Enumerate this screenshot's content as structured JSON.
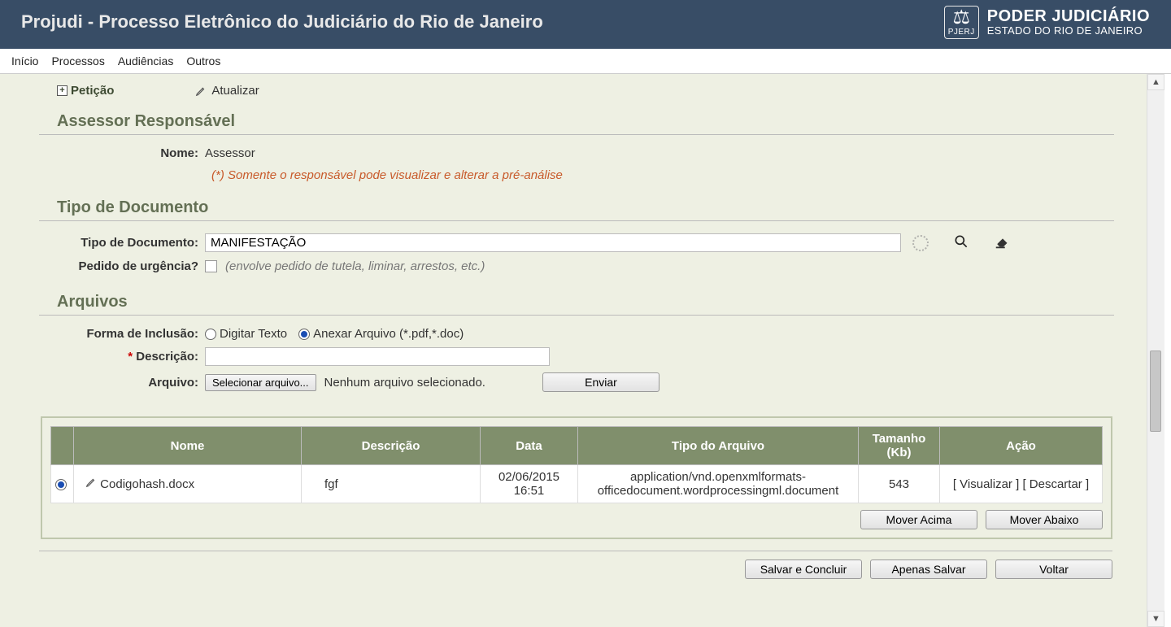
{
  "header": {
    "title": "Projudi - Processo Eletrônico do Judiciário do Rio de Janeiro",
    "logo_small": "PJERJ",
    "right_line1": "PODER JUDICIÁRIO",
    "right_line2": "ESTADO DO RIO DE JANEIRO"
  },
  "menu": {
    "inicio": "Início",
    "processos": "Processos",
    "audiencias": "Audiências",
    "outros": "Outros"
  },
  "top": {
    "peticao": "Petição",
    "atualizar": "Atualizar"
  },
  "assessor": {
    "title": "Assessor Responsável",
    "nome_label": "Nome:",
    "nome_value": "Assessor",
    "note": "(*) Somente o responsável pode visualizar e alterar a pré-análise"
  },
  "tipodoc": {
    "title": "Tipo de Documento",
    "label": "Tipo de Documento:",
    "value": "MANIFESTAÇÃO",
    "urgencia_label": "Pedido de urgência?",
    "urgencia_hint": "(envolve pedido de tutela, liminar, arrestos, etc.)"
  },
  "arquivos": {
    "title": "Arquivos",
    "forma_label": "Forma de Inclusão:",
    "opt_digitar": "Digitar Texto",
    "opt_anexar": "Anexar Arquivo (*.pdf,*.doc)",
    "descricao_label": "Descrição:",
    "arquivo_label": "Arquivo:",
    "select_btn": "Selecionar arquivo...",
    "no_file": "Nenhum arquivo selecionado.",
    "enviar_btn": "Enviar"
  },
  "table": {
    "h_nome": "Nome",
    "h_desc": "Descrição",
    "h_data": "Data",
    "h_tipo": "Tipo do Arquivo",
    "h_tam": "Tamanho (Kb)",
    "h_acao": "Ação",
    "row": {
      "nome": "Codigohash.docx",
      "desc": "fgf",
      "data": "02/06/2015 16:51",
      "tipo": "application/vnd.openxmlformats-officedocument.wordprocessingml.document",
      "tam": "543",
      "visualizar": "[ Visualizar ]",
      "descartar": "[ Descartar ]"
    },
    "mover_acima": "Mover Acima",
    "mover_abaixo": "Mover Abaixo"
  },
  "bottom": {
    "salvar_concluir": "Salvar e Concluir",
    "apenas_salvar": "Apenas Salvar",
    "voltar": "Voltar"
  }
}
